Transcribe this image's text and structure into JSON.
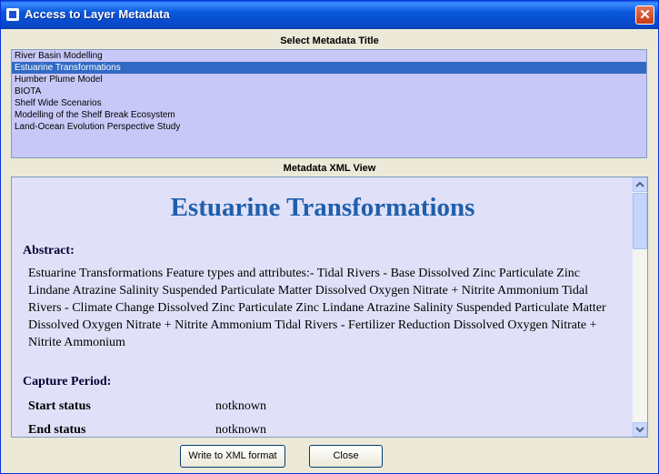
{
  "window": {
    "title": "Access to Layer Metadata",
    "close_symbol": "✕"
  },
  "select_section": {
    "label": "Select Metadata Title",
    "items": [
      "River Basin Modelling",
      "Estuarine Transformations",
      "Humber Plume Model",
      "BIOTA",
      "Shelf Wide Scenarios",
      "Modelling of the Shelf Break Ecosystem",
      "Land-Ocean Evolution Perspective Study"
    ],
    "selected_index": 1
  },
  "xml_section": {
    "label": "Metadata XML View",
    "doc_title": "Estuarine Transformations",
    "abstract_heading": "Abstract:",
    "abstract_text": "Estuarine Transformations Feature types and attributes:- Tidal Rivers - Base Dissolved Zinc Particulate Zinc Lindane Atrazine Salinity Suspended Particulate Matter Dissolved Oxygen Nitrate + Nitrite Ammonium Tidal Rivers - Climate Change Dissolved Zinc Particulate Zinc Lindane Atrazine Salinity Suspended Particulate Matter Dissolved Oxygen Nitrate + Nitrite Ammonium Tidal Rivers - Fertilizer Reduction Dissolved Oxygen Nitrate + Nitrite Ammonium",
    "capture_heading": "Capture Period:",
    "start_label": "Start status",
    "start_value": "notknown",
    "end_label": "End status",
    "end_value": "notknown"
  },
  "buttons": {
    "write_xml": "Write to XML format",
    "close": "Close"
  },
  "icons": {
    "app": "window-app-icon",
    "scroll_up": "arrow-up-icon",
    "scroll_down": "arrow-down-icon"
  },
  "colors": {
    "titlebar": "#0a58dc",
    "list_bg": "#c8c8f8",
    "selection": "#316ac5",
    "xml_bg": "#e0e0f8",
    "doc_title": "#1f5fad"
  }
}
